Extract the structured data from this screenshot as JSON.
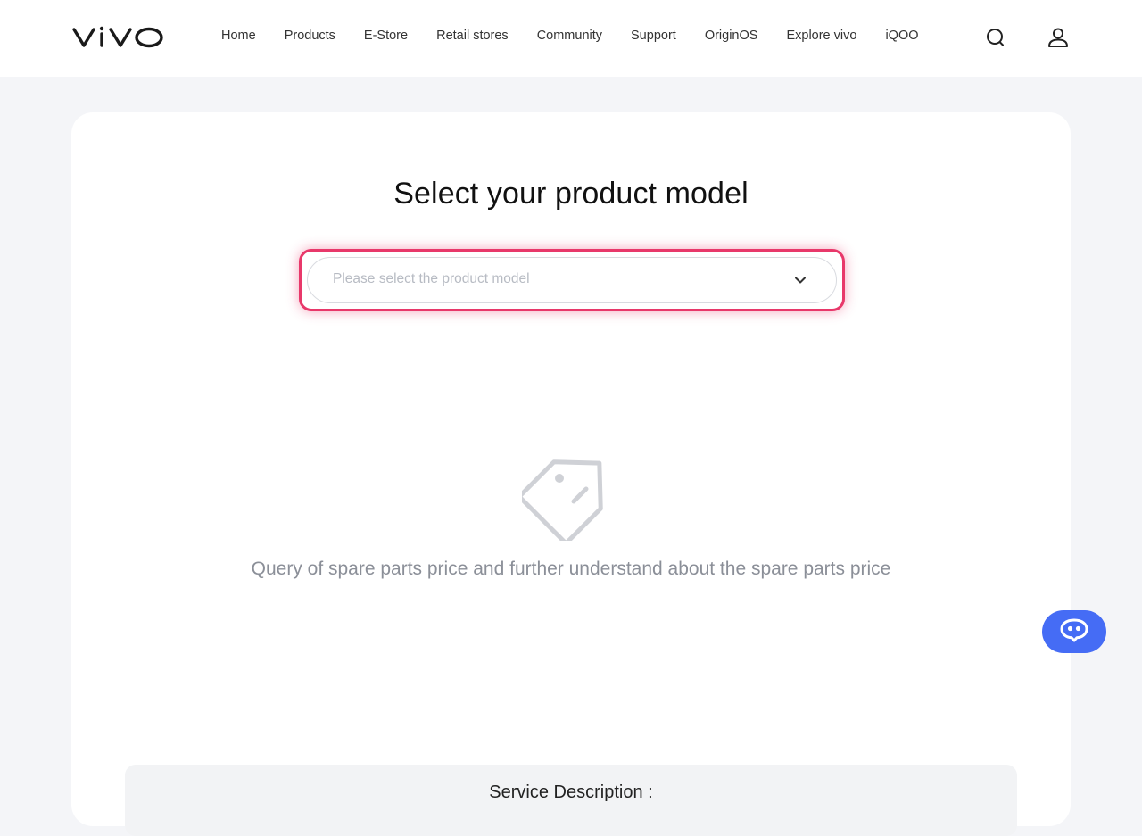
{
  "header": {
    "logo_text": "vivo",
    "nav": [
      "Home",
      "Products",
      "E-Store",
      "Retail stores",
      "Community",
      "Support",
      "OriginOS",
      "Explore vivo",
      "iQOO"
    ],
    "icons": [
      "search-icon",
      "user-icon"
    ]
  },
  "main": {
    "title": "Select your product model",
    "select": {
      "placeholder": "Please select the product model",
      "icon": "chevron-down-icon"
    },
    "empty_state": {
      "icon": "price-tag-icon",
      "text": "Query of spare parts price and further understand about the spare parts price"
    },
    "service": {
      "title": "Service Description :"
    }
  },
  "chat": {
    "icon": "chat-bot-icon"
  },
  "colors": {
    "accent": "#e8386a",
    "chat": "#456cf5",
    "background": "#f4f5f8"
  }
}
